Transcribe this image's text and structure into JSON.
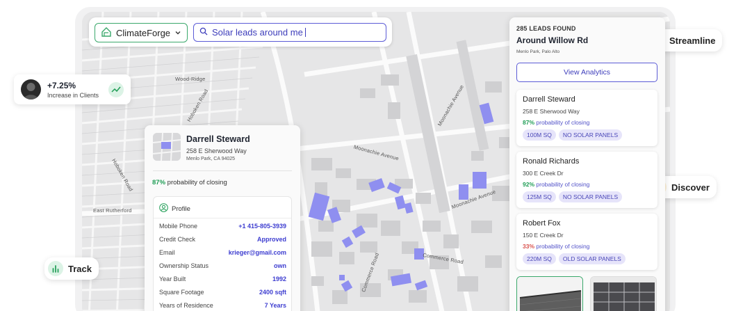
{
  "search": {
    "brand": "ClimateForge",
    "query": "Solar leads around me"
  },
  "tags": {
    "streamline": "Streamline",
    "discover": "Discover",
    "track": "Track"
  },
  "clients_card": {
    "value": "+7.25%",
    "label": "Increase in Clients"
  },
  "map_labels": [
    "Wood-Ridge",
    "Moonachie Avenue",
    "Moonachie Avenue",
    "East Rutherford",
    "Hoboken Road",
    "Hoboken Road",
    "Commerce Road",
    "Commerce Road",
    "Moonachie Avenue"
  ],
  "detail": {
    "name": "Darrell Steward",
    "address": "258 E Sherwood Way",
    "city": "Menlo Park, CA 94025",
    "prob_value": "87%",
    "prob_text": "probability of closing",
    "profile_title": "Profile",
    "rows": [
      {
        "label": "Mobile Phone",
        "value": "+1 415-805-3939"
      },
      {
        "label": "Credit Check",
        "value": "Approved"
      },
      {
        "label": "Email",
        "value": "krieger@gmail.com"
      },
      {
        "label": "Ownership Status",
        "value": "own"
      },
      {
        "label": "Year Built",
        "value": "1992"
      },
      {
        "label": "Square Footage",
        "value": "2400 sqft"
      },
      {
        "label": "Years of Residence",
        "value": "7 Years"
      }
    ]
  },
  "leads": {
    "count": "285 LEADS FOUND",
    "location": "Around Willow Rd",
    "city": "Menlo Park, Palo Alto",
    "view_analytics": "View Analytics",
    "items": [
      {
        "name": "Darrell Steward",
        "address": "258 E Sherwood Way",
        "prob": "87%",
        "prob_text": "probability of closing",
        "prob_color": "#1f9d55",
        "chips": [
          "100M SQ",
          "NO SOLAR PANELS"
        ]
      },
      {
        "name": "Ronald Richards",
        "address": "300 E Creek Dr",
        "prob": "92%",
        "prob_text": "probability of closing",
        "prob_color": "#1f9d55",
        "chips": [
          "125M SQ",
          "NO SOLAR PANELS"
        ]
      },
      {
        "name": "Robert Fox",
        "address": "150 E Creek Dr",
        "prob": "33%",
        "prob_text": "probability of closing",
        "prob_color": "#d9534f",
        "chips": [
          "220M SQ",
          "OLD SOLAR PANELS"
        ]
      }
    ]
  },
  "colors": {
    "accent": "#5b5bd6",
    "green": "#1f9d55",
    "red": "#d9534f",
    "highlight_building": "#8f8ff0"
  }
}
